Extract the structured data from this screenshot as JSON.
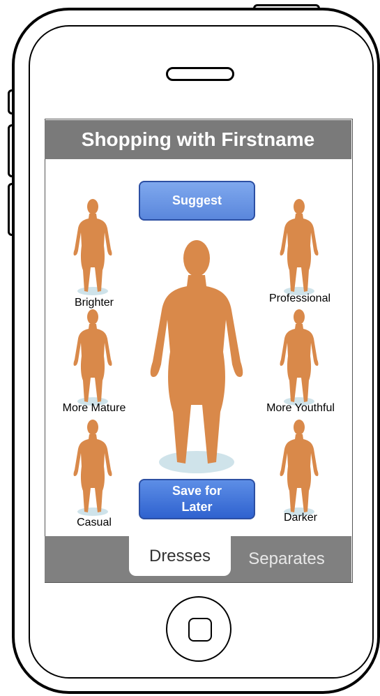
{
  "header": {
    "title": "Shopping with Firstname"
  },
  "actions": {
    "suggest_label": "Suggest",
    "save_label": "Save for\nLater"
  },
  "options": {
    "brighter": "Brighter",
    "professional": "Professional",
    "more_mature": "More Mature",
    "more_youthful": "More Youthful",
    "casual": "Casual",
    "darker": "Darker"
  },
  "tabs": {
    "dresses": "Dresses",
    "separates": "Separates"
  },
  "colors": {
    "figure": "#d9894a",
    "base": "#cfe3ea",
    "title_bg": "#7a7a7a",
    "tab_bg": "#808080",
    "button_blue": "#5a87dc"
  }
}
